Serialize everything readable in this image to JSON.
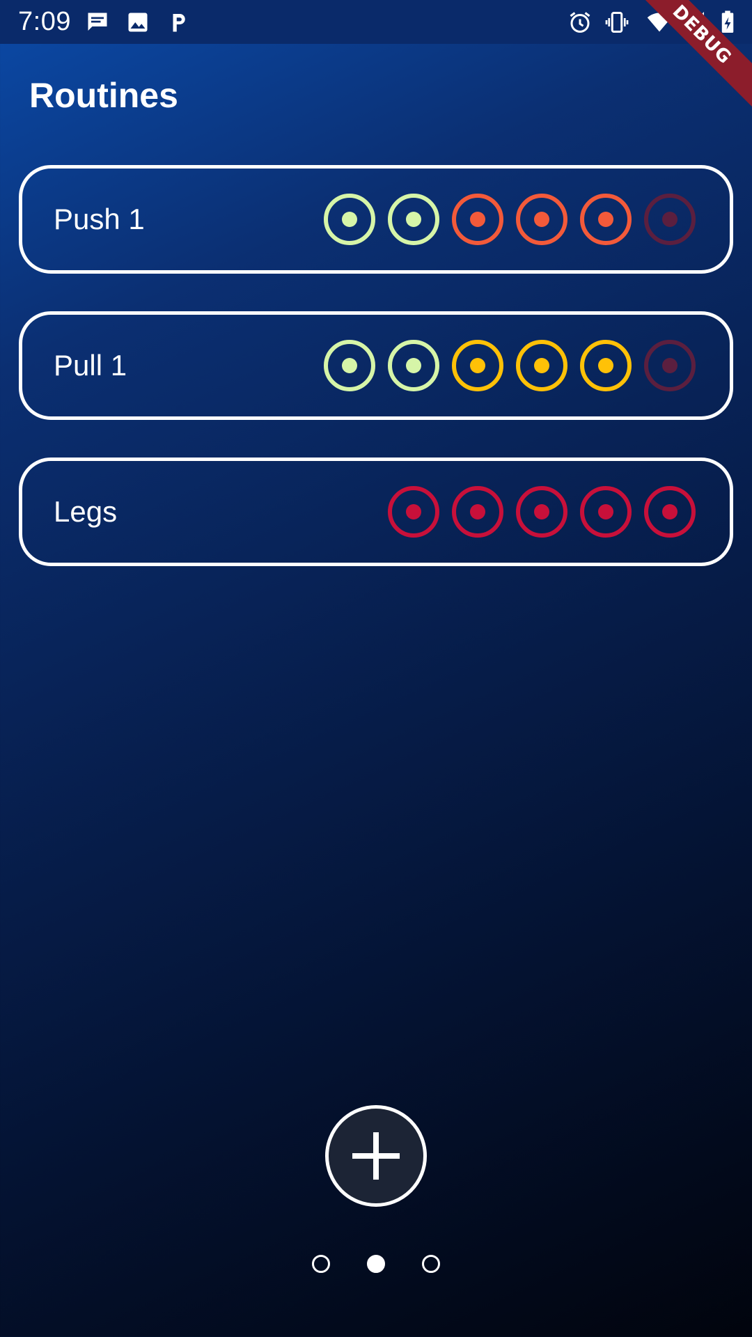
{
  "status_bar": {
    "time": "7:09",
    "left_icons": [
      "message-icon",
      "image-icon",
      "parking-icon"
    ],
    "right_icons": [
      "alarm-icon",
      "vibrate-icon",
      "wifi-icon",
      "signal-icon",
      "battery-charging-icon"
    ]
  },
  "debug_banner": "DEBUG",
  "header": {
    "title": "Routines"
  },
  "routines": [
    {
      "name": "Push 1",
      "sets": [
        "#d6f5a8",
        "#d6f5a8",
        "#f35a3a",
        "#f35a3a",
        "#f35a3a",
        "#5b1f3f"
      ]
    },
    {
      "name": "Pull 1",
      "sets": [
        "#d6f5a8",
        "#d6f5a8",
        "#ffc107",
        "#ffc107",
        "#ffc107",
        "#5b1f3f"
      ]
    },
    {
      "name": "Legs",
      "sets": [
        "#c8103a",
        "#c8103a",
        "#c8103a",
        "#c8103a",
        "#c8103a"
      ]
    }
  ],
  "add_button": {
    "icon": "plus-icon"
  },
  "pagination": {
    "count": 3,
    "active_index": 1
  }
}
